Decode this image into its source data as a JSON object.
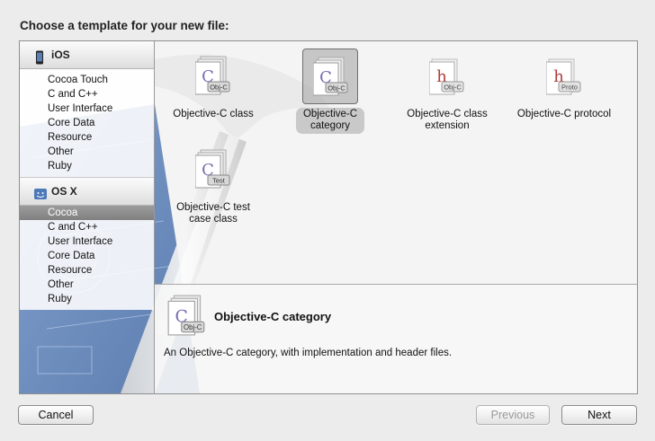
{
  "dialog": {
    "title": "Choose a template for your new file:"
  },
  "sidebar": {
    "sections": [
      {
        "header": "iOS",
        "icon": "iphone-icon",
        "items": [
          "Cocoa Touch",
          "C and C++",
          "User Interface",
          "Core Data",
          "Resource",
          "Other",
          "Ruby"
        ]
      },
      {
        "header": "OS X",
        "icon": "mac-osx-icon",
        "items": [
          "Cocoa",
          "C and C++",
          "User Interface",
          "Core Data",
          "Resource",
          "Other",
          "Ruby"
        ],
        "selected_item": "Cocoa"
      }
    ]
  },
  "templates": [
    {
      "label_line1": "Objective-C class",
      "label_line2": "",
      "badge": "Obj-C",
      "letter": "C",
      "selected": false
    },
    {
      "label_line1": "Objective-C",
      "label_line2": "category",
      "badge": "Obj-C",
      "letter": "C",
      "selected": true
    },
    {
      "label_line1": "Objective-C class",
      "label_line2": "extension",
      "badge": "Obj-C",
      "letter": "h",
      "selected": false
    },
    {
      "label_line1": "Objective-C protocol",
      "label_line2": "",
      "badge": "Proto",
      "letter": "h",
      "selected": false
    },
    {
      "label_line1": "Objective-C test",
      "label_line2": "case class",
      "badge": "Test",
      "letter": "C",
      "selected": false
    }
  ],
  "detail": {
    "title": "Objective-C category",
    "description": "An Objective-C category, with implementation and header files.",
    "badge": "Obj-C",
    "letter": "C"
  },
  "buttons": {
    "cancel": "Cancel",
    "previous": "Previous",
    "next": "Next"
  },
  "colors": {
    "selection": "#8a8a8a",
    "blueprint": "#5a7fb3",
    "c_letter": "#7a6bb0",
    "h_letter": "#b03a3a"
  }
}
